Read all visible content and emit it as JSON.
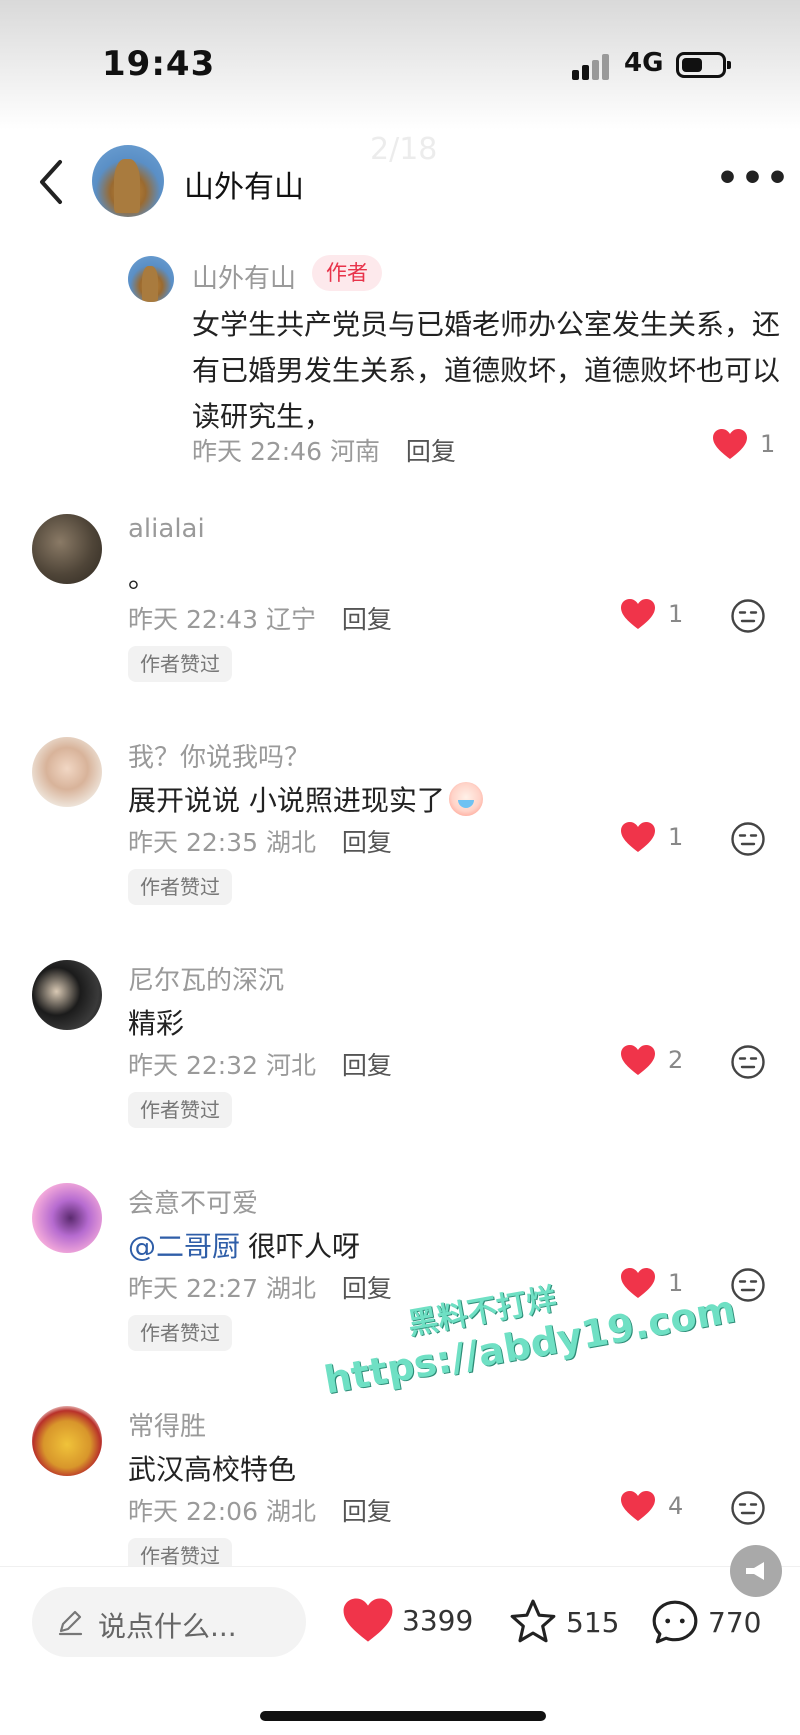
{
  "status_bar": {
    "time": "19:43",
    "network": "4G"
  },
  "header": {
    "title": "山外有山",
    "ghost_counter": "2/18",
    "ghost_close": "✕",
    "more": "•••"
  },
  "reply": {
    "name": "山外有山",
    "badge": "作者",
    "text": "女学生共产党员与已婚老师办公室发生关系，还有已婚男发生关系，道德败坏，道德败坏也可以读研究生，",
    "time": "昨天 22:46",
    "location": "河南",
    "reply_label": "回复",
    "likes": "1"
  },
  "comments": [
    {
      "name": "alialai",
      "mention": "",
      "text": "。",
      "time": "昨天 22:43",
      "location": "辽宁",
      "reply_label": "回复",
      "likes": "1",
      "approved": "作者赞过"
    },
    {
      "name": "我？你说我吗？",
      "mention": "",
      "text": "展开说说 小说照进现实了",
      "time": "昨天 22:35",
      "location": "湖北",
      "reply_label": "回复",
      "likes": "1",
      "approved": "作者赞过"
    },
    {
      "name": "尼尔瓦的深沉",
      "mention": "",
      "text": "精彩",
      "time": "昨天 22:32",
      "location": "河北",
      "reply_label": "回复",
      "likes": "2",
      "approved": "作者赞过"
    },
    {
      "name": "会意不可爱",
      "mention": "@二哥厨",
      "text": "很吓人呀",
      "time": "昨天 22:27",
      "location": "湖北",
      "reply_label": "回复",
      "likes": "1",
      "approved": "作者赞过"
    },
    {
      "name": "常得胜",
      "mention": "",
      "text": "武汉高校特色",
      "time": "昨天 22:06",
      "location": "湖北",
      "reply_label": "回复",
      "likes": "4",
      "approved": "作者赞过"
    }
  ],
  "watermark": {
    "line1": "黑料不打烊",
    "line2": "https://abdy19.com"
  },
  "bottom_bar": {
    "input_placeholder": "说点什么...",
    "likes": "3399",
    "stars": "515",
    "comments": "770"
  },
  "icons": {
    "back": "chevron-left-icon",
    "more": "more-dots-icon",
    "like": "heart-icon",
    "dislike": "neutral-face-icon",
    "star": "star-icon",
    "chat": "chat-bubble-icon",
    "edit": "pencil-icon",
    "float": "megaphone-icon"
  },
  "colors": {
    "heart": "#f0344a",
    "author_badge": "#e8334a",
    "mention": "#2f5ea8",
    "watermark": "#6fe0c4"
  }
}
